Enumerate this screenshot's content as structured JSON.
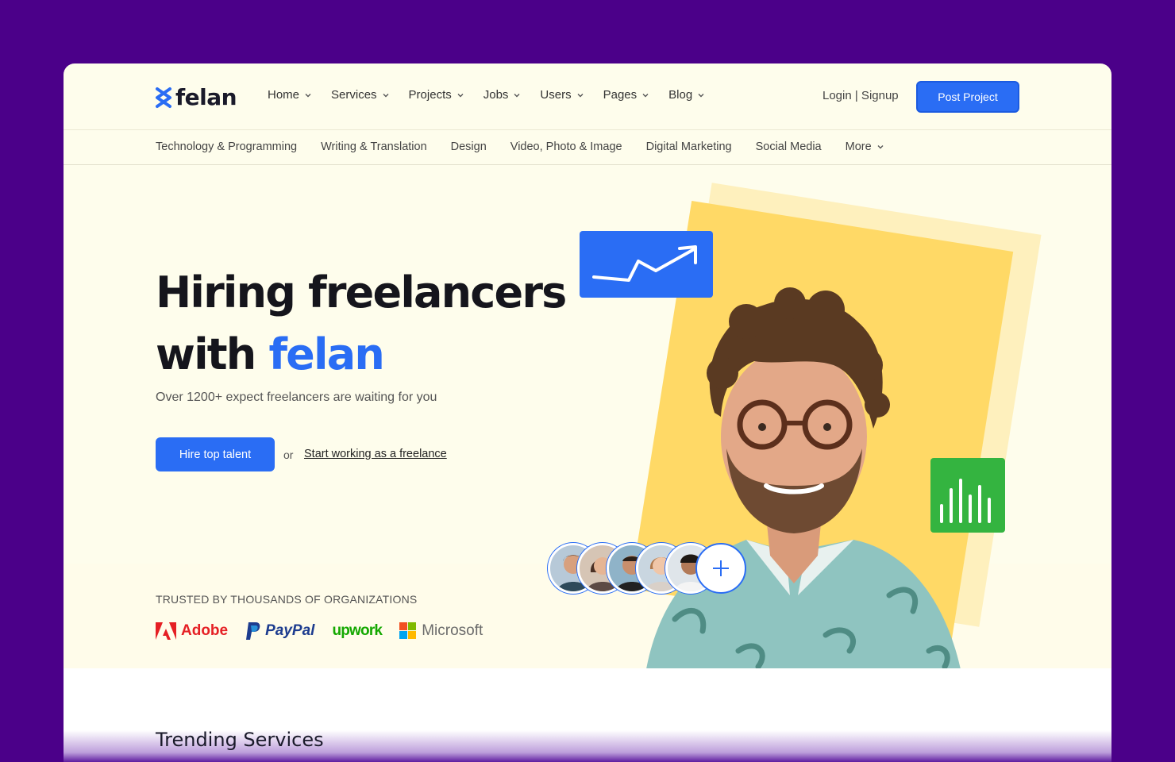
{
  "brand": {
    "name": "felan",
    "accent": "#2a6df4"
  },
  "nav": {
    "items": [
      {
        "label": "Home"
      },
      {
        "label": "Services"
      },
      {
        "label": "Projects"
      },
      {
        "label": "Jobs"
      },
      {
        "label": "Users"
      },
      {
        "label": "Pages"
      },
      {
        "label": "Blog"
      }
    ],
    "login": "Login | Signup",
    "post_project": "Post Project"
  },
  "categories": {
    "items": [
      {
        "label": "Technology & Programming"
      },
      {
        "label": "Writing & Translation"
      },
      {
        "label": "Design"
      },
      {
        "label": "Video, Photo & Image"
      },
      {
        "label": "Digital Marketing"
      },
      {
        "label": "Social Media"
      },
      {
        "label": "More"
      }
    ]
  },
  "hero": {
    "title_line1": "Hiring freelancers",
    "title_with": "with ",
    "title_accent": "felan",
    "subtitle": "Over 1200+ expect freelancers are waiting for you",
    "hire_button": "Hire top talent",
    "or": "or",
    "start_link": "Start working as a freelance"
  },
  "trusted": {
    "heading": "TRUSTED BY THOUSANDS OF ORGANIZATIONS",
    "brands": [
      {
        "name": "Adobe",
        "icon": "adobe-logo"
      },
      {
        "name": "PayPal",
        "icon": "paypal-logo"
      },
      {
        "name": "upwork",
        "icon": "upwork-logo"
      },
      {
        "name": "Microsoft",
        "icon": "microsoft-logo"
      }
    ]
  },
  "trending": {
    "heading": "Trending Services"
  },
  "colors": {
    "background": "#4b0089",
    "page": "#fefdec",
    "yellow": "#ffd966",
    "green": "#34b440"
  }
}
